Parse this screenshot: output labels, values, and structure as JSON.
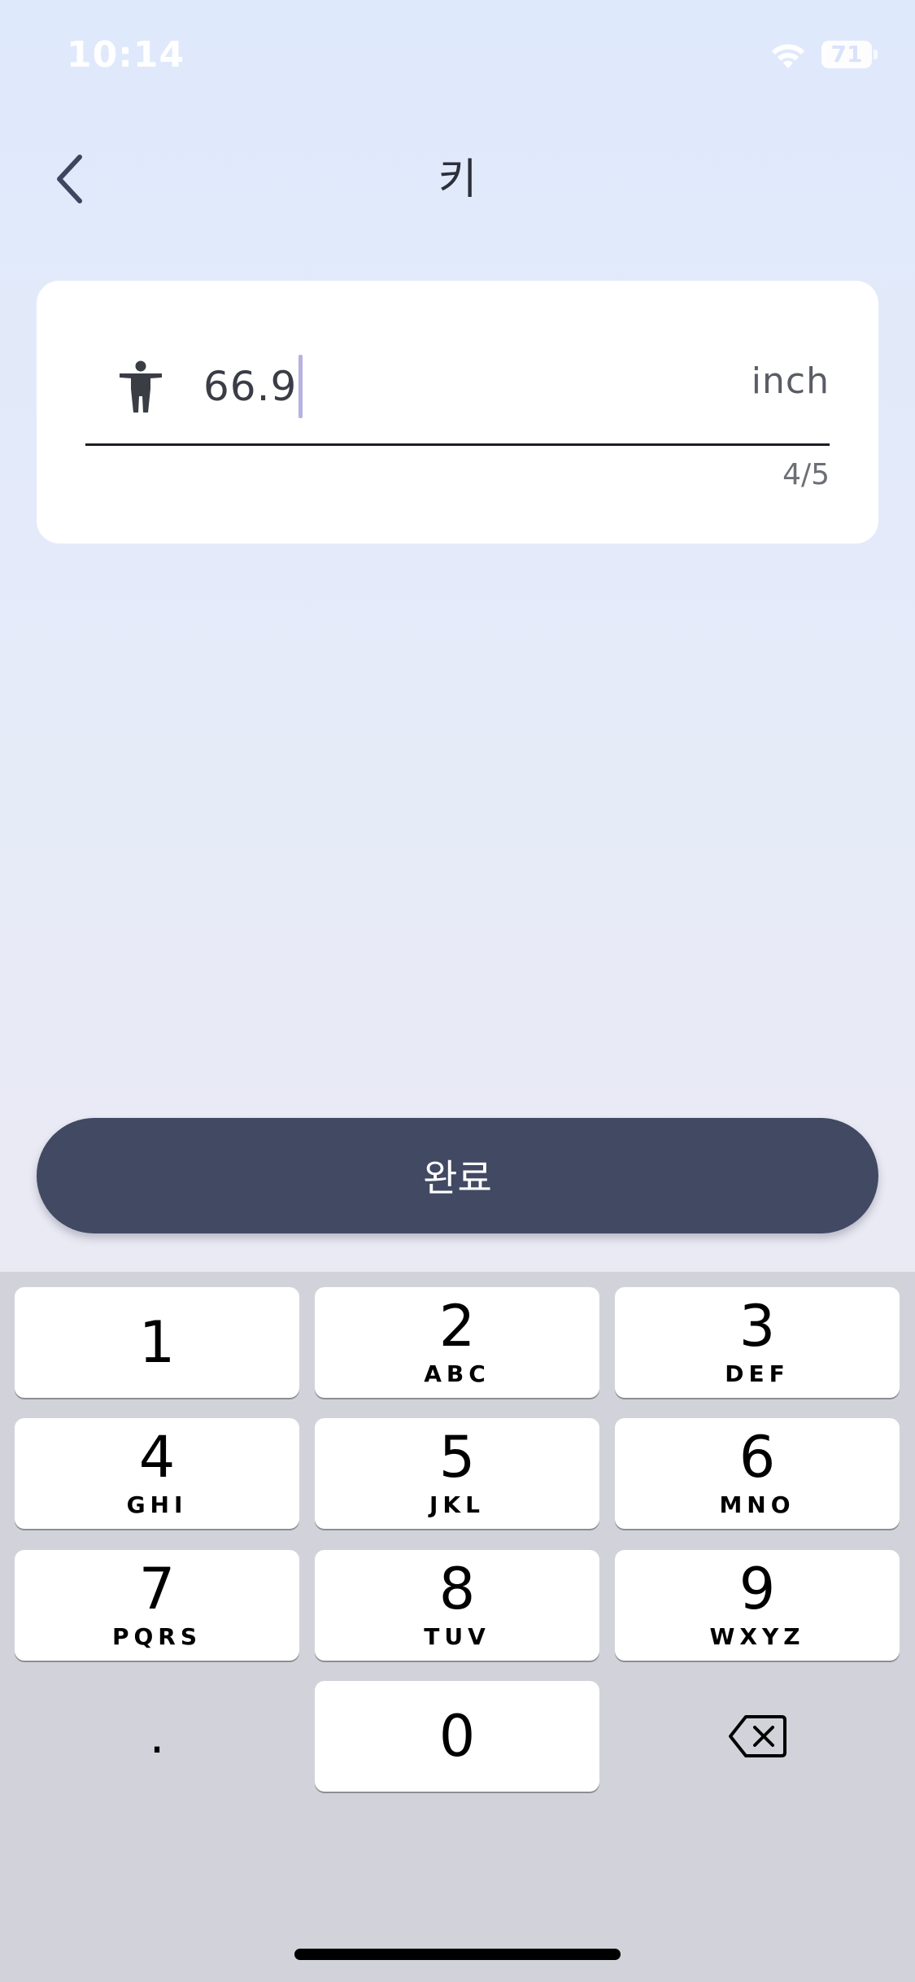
{
  "status_bar": {
    "time": "10:14",
    "battery": "71",
    "icons": [
      "wifi-icon",
      "battery-icon"
    ]
  },
  "nav": {
    "title": "키",
    "back_icon": "chevron-left-icon"
  },
  "height_field": {
    "icon": "person-standing-icon",
    "value": "66.9",
    "unit": "inch",
    "counter": "4/5"
  },
  "done_button": {
    "label": "완료",
    "color": "#414963"
  },
  "keypad": {
    "keys": [
      {
        "digit": "1",
        "letters": ""
      },
      {
        "digit": "2",
        "letters": "ABC"
      },
      {
        "digit": "3",
        "letters": "DEF"
      },
      {
        "digit": "4",
        "letters": "GHI"
      },
      {
        "digit": "5",
        "letters": "JKL"
      },
      {
        "digit": "6",
        "letters": "MNO"
      },
      {
        "digit": "7",
        "letters": "PQRS"
      },
      {
        "digit": "8",
        "letters": "TUV"
      },
      {
        "digit": "9",
        "letters": "WXYZ"
      },
      {
        "digit": "0",
        "letters": ""
      }
    ],
    "decimal": ".",
    "backspace_icon": "backspace-icon"
  }
}
